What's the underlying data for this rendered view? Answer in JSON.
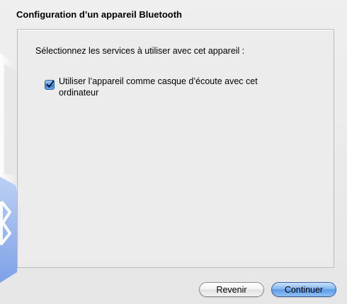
{
  "window": {
    "title": "Configuration d’un appareil Bluetooth"
  },
  "panel": {
    "prompt": "Sélectionnez les services à utiliser avec cet appareil :",
    "options": [
      {
        "label": "Utiliser l’appareil comme casque d’écoute avec cet ordinateur",
        "checked": true
      }
    ]
  },
  "buttons": {
    "back_label": "Revenir",
    "continue_label": "Continuer"
  },
  "colors": {
    "accent": "#5c9be6",
    "bluetooth_art": "#8fb0ea"
  },
  "icons": {
    "background_art": "bluetooth-logo-icon",
    "checkmark": "checkmark-icon"
  }
}
